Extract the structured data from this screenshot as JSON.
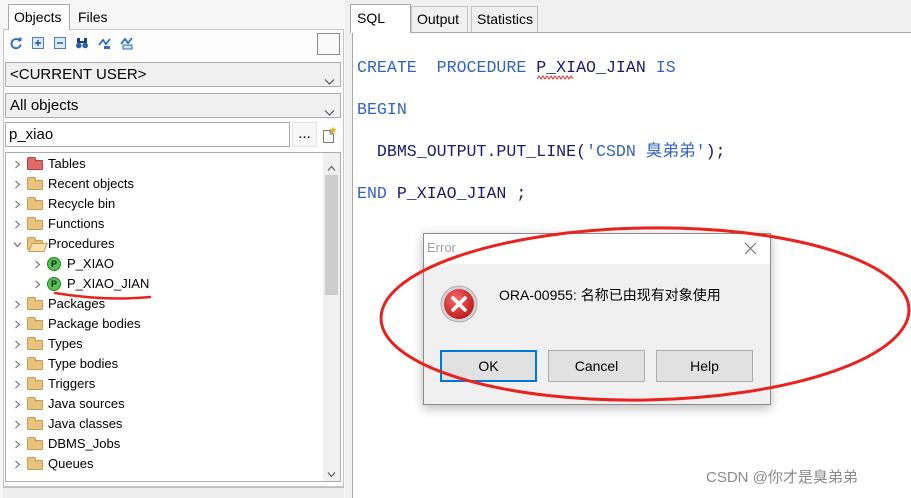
{
  "objects_panel": {
    "tabs": {
      "objects": "Objects",
      "files": "Files"
    },
    "toolbar_icons": [
      "refresh-icon",
      "expand-all-icon",
      "collapse-all-icon",
      "find-icon",
      "filter-icon",
      "filter-edit-icon"
    ],
    "owner_select": "<CURRENT USER>",
    "type_select": "All objects",
    "search": {
      "value": "p_xiao",
      "browse_label": "..."
    },
    "procedure_badge": "P",
    "tree": {
      "items": [
        {
          "label": "Tables",
          "icon": "table-folder-icon"
        },
        {
          "label": "Recent objects",
          "icon": "folder-icon"
        },
        {
          "label": "Recycle bin",
          "icon": "folder-icon"
        },
        {
          "label": "Functions",
          "icon": "folder-icon"
        },
        {
          "label": "Procedures",
          "icon": "open-folder-icon",
          "expanded": true,
          "children": [
            {
              "label": "P_XIAO",
              "icon": "procedure-icon"
            },
            {
              "label": "P_XIAO_JIAN",
              "icon": "procedure-icon"
            }
          ]
        },
        {
          "label": "Packages",
          "icon": "folder-icon"
        },
        {
          "label": "Package bodies",
          "icon": "folder-icon"
        },
        {
          "label": "Types",
          "icon": "folder-icon"
        },
        {
          "label": "Type bodies",
          "icon": "folder-icon"
        },
        {
          "label": "Triggers",
          "icon": "folder-icon"
        },
        {
          "label": "Java sources",
          "icon": "folder-icon"
        },
        {
          "label": "Java classes",
          "icon": "folder-icon"
        },
        {
          "label": "DBMS_Jobs",
          "icon": "folder-icon"
        },
        {
          "label": "Queues",
          "icon": "folder-icon"
        }
      ]
    }
  },
  "editor": {
    "tabs": {
      "sql": "SQL",
      "output": "Output",
      "statistics": "Statistics"
    },
    "code": {
      "line1": {
        "create": "CREATE",
        "procedure": "PROCEDURE",
        "name": "P_XIAO_JIAN",
        "is": "IS"
      },
      "line2": {
        "begin": "BEGIN"
      },
      "line3": {
        "call": "DBMS_OUTPUT.PUT_LINE",
        "open": "(",
        "string": "'CSDN 臭弟弟'",
        "close": ");"
      },
      "line4": {
        "end": "END",
        "name": "P_XIAO_JIAN",
        "semicolon": ";"
      }
    }
  },
  "error_dialog": {
    "title": "Error",
    "icon": "error-icon",
    "message": "ORA-00955: 名称已由现有对象使用",
    "buttons": {
      "ok": "OK",
      "cancel": "Cancel",
      "help": "Help"
    }
  },
  "watermark": "CSDN @你才是臭弟弟",
  "colors": {
    "keyword": "#3164c4",
    "identifier": "#1c1c6e",
    "string": "#3164c4",
    "spell_error": "#e0302a",
    "annotation": "#e8231f",
    "focus_border": "#0078d7",
    "error_icon": "#d42a2a",
    "procedure_icon": "#55c455"
  }
}
